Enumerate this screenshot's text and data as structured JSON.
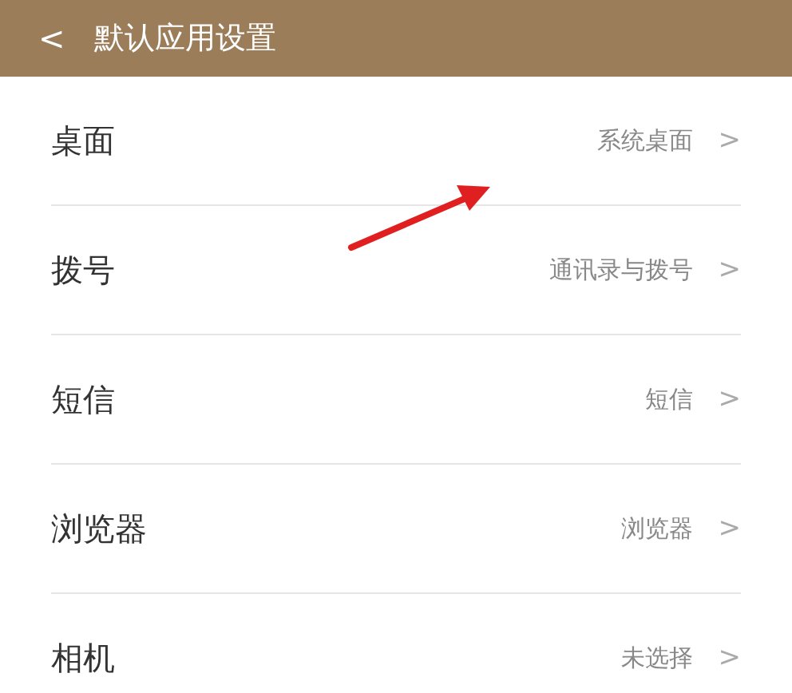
{
  "header": {
    "back": "<",
    "title": "默认应用设置"
  },
  "items": [
    {
      "label": "桌面",
      "value": "系统桌面",
      "chevron": ">"
    },
    {
      "label": "拨号",
      "value": "通讯录与拨号",
      "chevron": ">"
    },
    {
      "label": "短信",
      "value": "短信",
      "chevron": ">"
    },
    {
      "label": "浏览器",
      "value": "浏览器",
      "chevron": ">"
    },
    {
      "label": "相机",
      "value": "未选择",
      "chevron": ">"
    }
  ]
}
